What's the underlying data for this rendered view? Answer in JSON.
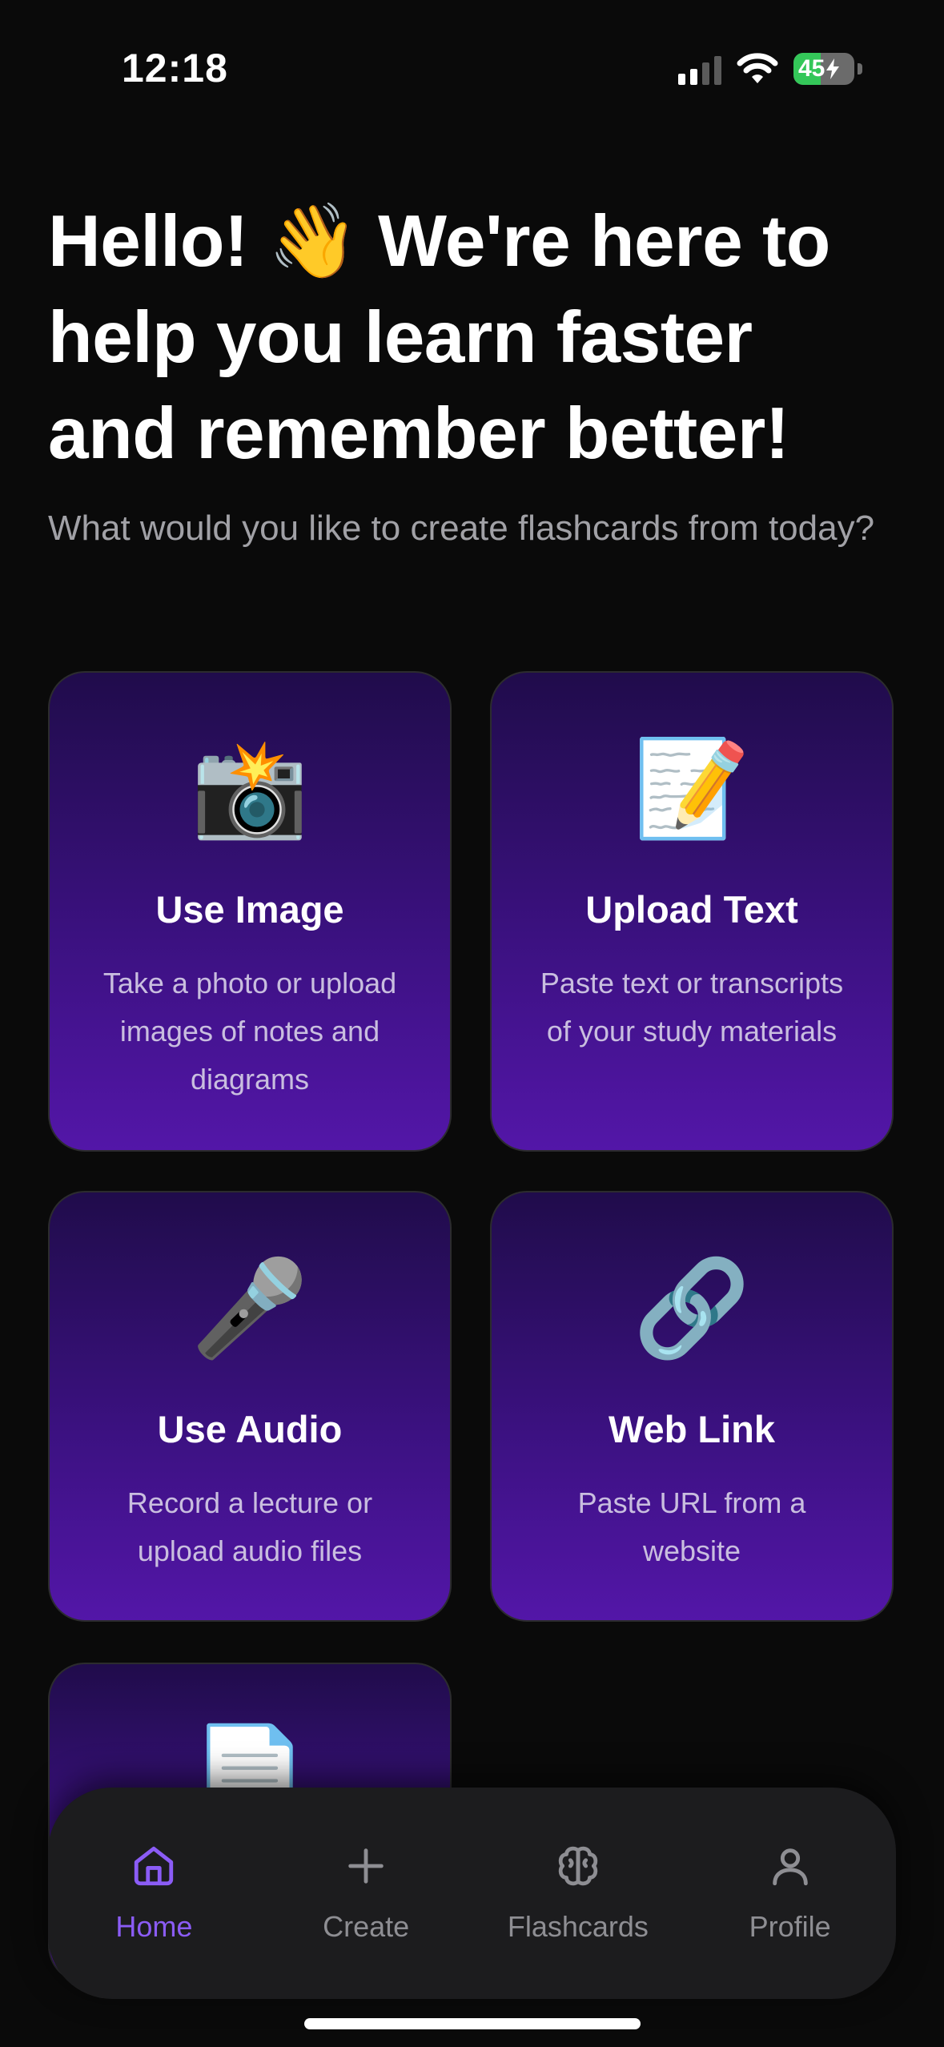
{
  "status_bar": {
    "time": "12:18",
    "battery_level": "45",
    "battery_percent": 45,
    "icons": [
      "cellular-signal-icon",
      "wifi-icon",
      "battery-charging-icon"
    ]
  },
  "hero": {
    "title": "Hello! 👋 We're here to help you learn faster and remember better!",
    "subtitle": "What would you like to create flashcards from today?"
  },
  "cards": [
    {
      "emoji": "📸",
      "icon": "camera-flash-icon",
      "title": "Use Image",
      "description": "Take a photo or upload images of notes and diagrams"
    },
    {
      "emoji": "📝",
      "icon": "memo-icon",
      "title": "Upload Text",
      "description": "Paste text or transcripts of your study materials"
    },
    {
      "emoji": "🎤",
      "icon": "microphone-icon",
      "title": "Use Audio",
      "description": "Record a lecture or upload audio files"
    },
    {
      "emoji": "🔗",
      "icon": "link-icon",
      "title": "Web Link",
      "description": "Paste URL from a website"
    },
    {
      "emoji": "📄",
      "icon": "document-icon",
      "title": "",
      "description": ""
    }
  ],
  "bottom_nav": {
    "items": [
      {
        "label": "Home",
        "icon": "home-icon",
        "active": true
      },
      {
        "label": "Create",
        "icon": "plus-icon",
        "active": false
      },
      {
        "label": "Flashcards",
        "icon": "brain-icon",
        "active": false
      },
      {
        "label": "Profile",
        "icon": "user-icon",
        "active": false
      }
    ]
  },
  "colors": {
    "background": "#0a0a0a",
    "accent": "#8b5cf6",
    "card_gradient_top": "#200c4b",
    "card_gradient_bottom": "#5316a8",
    "nav_background": "#1c1c1e",
    "battery": "#34c759"
  }
}
